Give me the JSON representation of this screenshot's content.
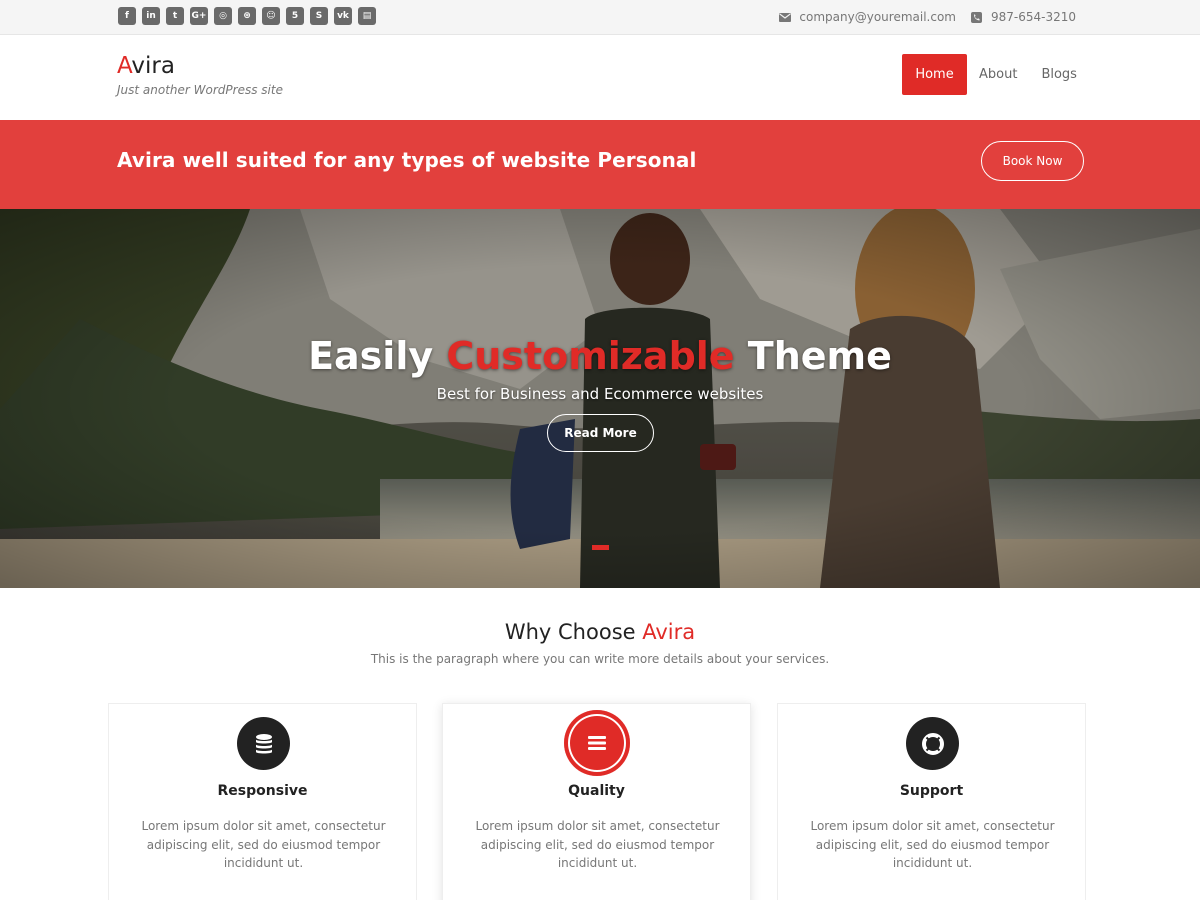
{
  "topbar": {
    "social_icons": [
      {
        "name": "facebook-icon",
        "glyph": "f"
      },
      {
        "name": "linkedin-icon",
        "glyph": "in"
      },
      {
        "name": "twitter-icon",
        "glyph": "t"
      },
      {
        "name": "google-plus-icon",
        "glyph": "G+"
      },
      {
        "name": "instagram-icon",
        "glyph": "◎"
      },
      {
        "name": "dribbble-icon",
        "glyph": "⊛"
      },
      {
        "name": "reddit-icon",
        "glyph": "☺"
      },
      {
        "name": "html5-icon",
        "glyph": "5"
      },
      {
        "name": "skype-icon",
        "glyph": "S"
      },
      {
        "name": "vk-icon",
        "glyph": "vk"
      },
      {
        "name": "foursquare-icon",
        "glyph": "▤"
      }
    ],
    "email": "company@youremail.com",
    "phone": "987-654-3210"
  },
  "header": {
    "logo_first": "A",
    "logo_rest": "vira",
    "tagline": "Just another WordPress site",
    "nav": [
      {
        "label": "Home",
        "active": true
      },
      {
        "label": "About",
        "active": false
      },
      {
        "label": "Blogs",
        "active": false
      }
    ]
  },
  "banner": {
    "text": "Avira well suited for any types of website Personal",
    "button": "Book Now"
  },
  "hero": {
    "title_pre": "Easily ",
    "title_highlight": "Customizable",
    "title_post": " Theme",
    "subtitle": "Best for Business and Ecommerce websites",
    "button": "Read More"
  },
  "why": {
    "title_pre": "Why Choose ",
    "title_highlight": "Avira",
    "subtitle": "This is the paragraph where you can write more details about your services."
  },
  "features": [
    {
      "title": "Responsive",
      "icon": "database-icon",
      "text": "Lorem ipsum dolor sit amet, consectetur adipiscing elit, sed do eiusmod tempor incididunt ut."
    },
    {
      "title": "Quality",
      "icon": "list-icon",
      "text": "Lorem ipsum dolor sit amet, consectetur adipiscing elit, sed do eiusmod tempor incididunt ut."
    },
    {
      "title": "Support",
      "icon": "life-ring-icon",
      "text": "Lorem ipsum dolor sit amet, consectetur adipiscing elit, sed do eiusmod tempor incididunt ut."
    }
  ],
  "colors": {
    "accent": "#e02b27",
    "banner": "#e2403d"
  }
}
